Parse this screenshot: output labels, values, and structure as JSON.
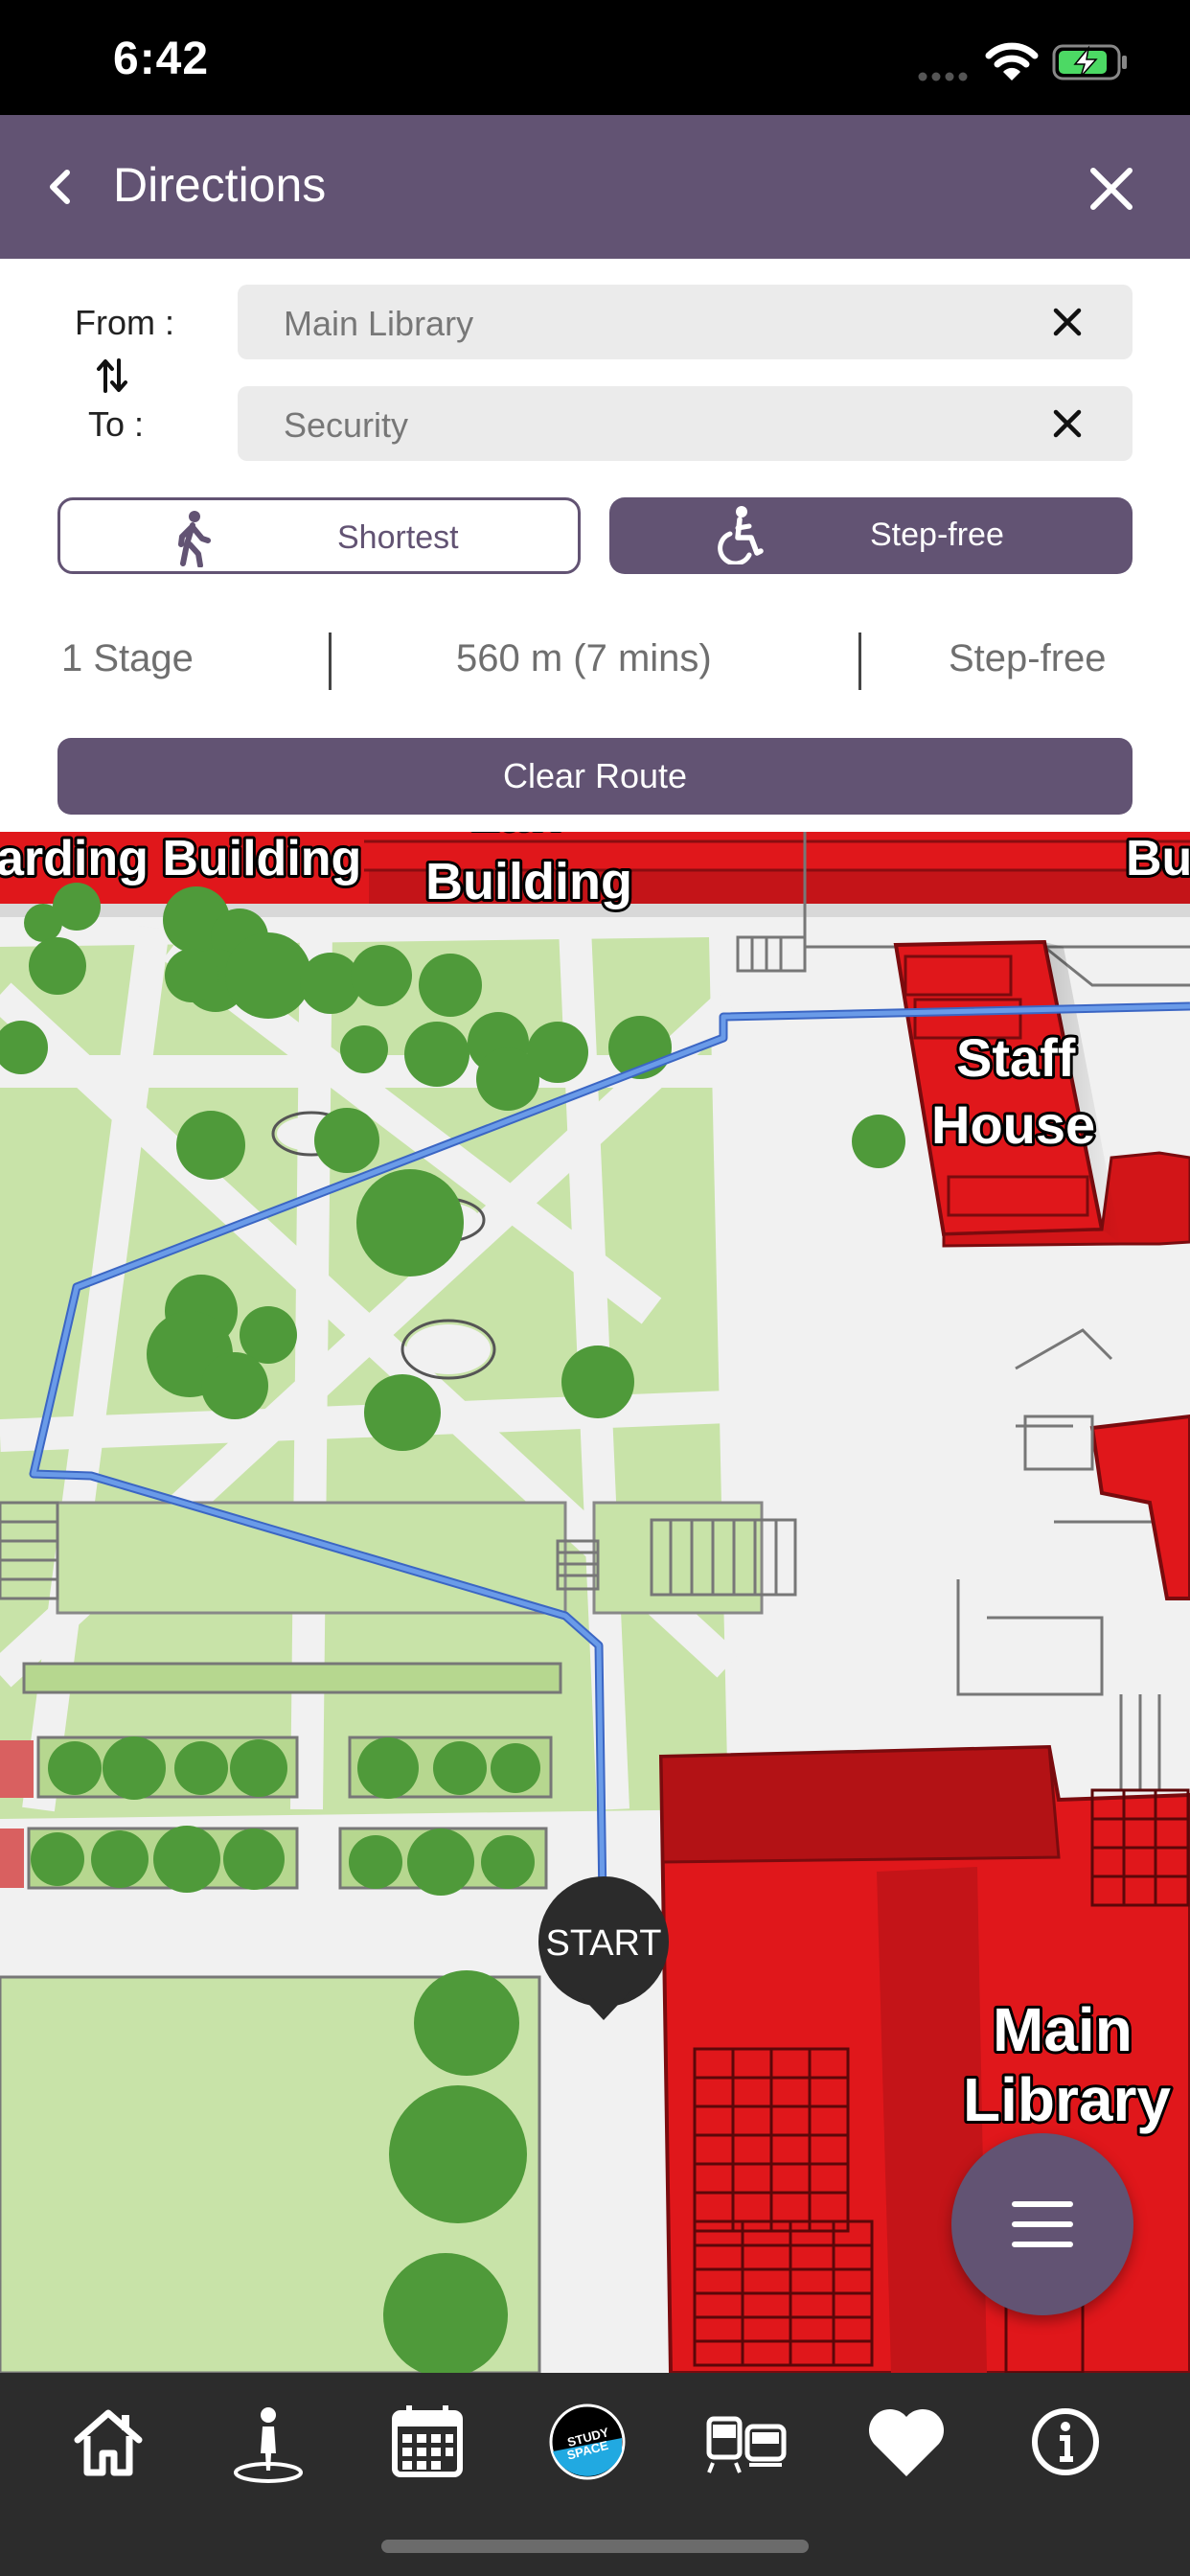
{
  "status": {
    "time": "6:42"
  },
  "header": {
    "title": "Directions"
  },
  "form": {
    "from_label": "From :",
    "to_label": "To :",
    "from_value": "Main Library",
    "to_value": "Security"
  },
  "modes": {
    "shortest_label": "Shortest",
    "stepfree_label": "Step-free",
    "selected": "Step-free"
  },
  "summary": {
    "stages": "1 Stage",
    "distance": "560 m (7 mins)",
    "type": "Step-free"
  },
  "clear_label": "Clear Route",
  "map": {
    "labels": {
      "harding": "arding Building",
      "law_1": "Law",
      "law_2": "Building",
      "bu": "Bu",
      "staff_1": "Staff",
      "staff_2": "House",
      "main_1": "Main",
      "main_2": "Library"
    },
    "start_marker": "START",
    "study_space_1": "STUDY",
    "study_space_2": "SPACE",
    "colors": {
      "building": "#e0171b",
      "grass": "#c8e3a8",
      "tree": "#4f9a3a",
      "route": "#6a9be8"
    }
  },
  "tabbar": {
    "icons": [
      "home-icon",
      "pedestrian-location-icon",
      "calendar-icon",
      "study-space-icon",
      "transport-icon",
      "heart-icon",
      "info-icon"
    ]
  }
}
